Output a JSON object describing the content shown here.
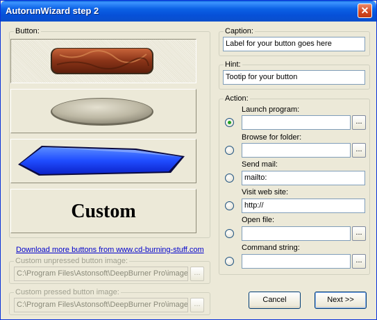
{
  "window": {
    "title": "AutorunWizard step 2",
    "close_glyph": "✕"
  },
  "button_group": {
    "legend": "Button:",
    "options": [
      {
        "name": "brown-marble-rounded-button",
        "selected": true
      },
      {
        "name": "gray-stone-oval-button",
        "selected": false
      },
      {
        "name": "blue-hexagon-button",
        "selected": false
      },
      {
        "name": "custom-button",
        "label": "Custom",
        "selected": false
      }
    ],
    "download_link": "Download more buttons from www.cd-burning-stuff.com"
  },
  "unpressed": {
    "legend": "Custom unpressed button image:",
    "value": "C:\\Program Files\\Astonsoft\\DeepBurner Pro\\images",
    "browse": "..."
  },
  "pressed": {
    "legend": "Custom pressed button image:",
    "value": "C:\\Program Files\\Astonsoft\\DeepBurner Pro\\images",
    "browse": "..."
  },
  "caption": {
    "legend": "Caption:",
    "value": "Label for your button goes here"
  },
  "hint": {
    "legend": "Hint:",
    "value": "Tootip for your button"
  },
  "action": {
    "legend": "Action:",
    "items": [
      {
        "label": "Launch program:",
        "value": "",
        "has_browse": true,
        "selected": true
      },
      {
        "label": "Browse for folder:",
        "value": "",
        "has_browse": true,
        "selected": false
      },
      {
        "label": "Send mail:",
        "value": "mailto:",
        "has_browse": false,
        "selected": false
      },
      {
        "label": "Visit web site:",
        "value": "http://",
        "has_browse": false,
        "selected": false
      },
      {
        "label": "Open file:",
        "value": "",
        "has_browse": true,
        "selected": false
      },
      {
        "label": "Command string:",
        "value": "",
        "has_browse": true,
        "selected": false
      }
    ],
    "browse": "..."
  },
  "buttons": {
    "cancel": "Cancel",
    "next": "Next >>"
  }
}
